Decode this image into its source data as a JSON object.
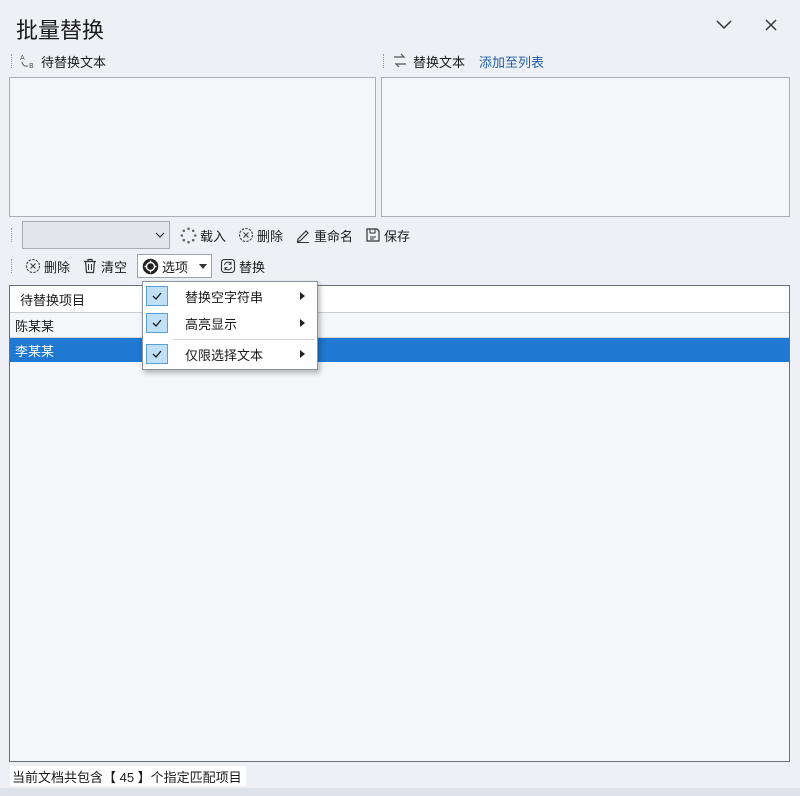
{
  "window": {
    "title": "批量替换",
    "minimize_symbol": "﹀",
    "close_symbol": "✕"
  },
  "find_panel": {
    "label": "待替换文本",
    "icon": "find-text-icon",
    "value": ""
  },
  "replace_panel": {
    "label": "替换文本",
    "icon": "replace-text-icon",
    "link_label": "添加至列表",
    "value": ""
  },
  "list_toolbar": {
    "combo_value": "",
    "load_label": "载入",
    "delete_label": "删除",
    "rename_label": "重命名",
    "save_label": "保存"
  },
  "action_toolbar": {
    "delete_label": "删除",
    "clear_label": "清空",
    "options_label": "选项",
    "replace_label": "替换"
  },
  "options_menu": {
    "items": [
      {
        "label": "替换空字符串",
        "checked": true
      },
      {
        "label": "高亮显示",
        "checked": true
      },
      {
        "label": "仅限选择文本",
        "checked": true
      }
    ]
  },
  "table": {
    "header": "待替换项目",
    "rows": [
      {
        "text": "陈某某",
        "selected": false
      },
      {
        "text": "李某某",
        "selected": true
      }
    ]
  },
  "status": {
    "text": "当前文档共包含【 45 】个指定匹配项目"
  },
  "colors": {
    "selection": "#1f78d1",
    "link": "#1f5fa8",
    "background": "#eef0f5"
  }
}
